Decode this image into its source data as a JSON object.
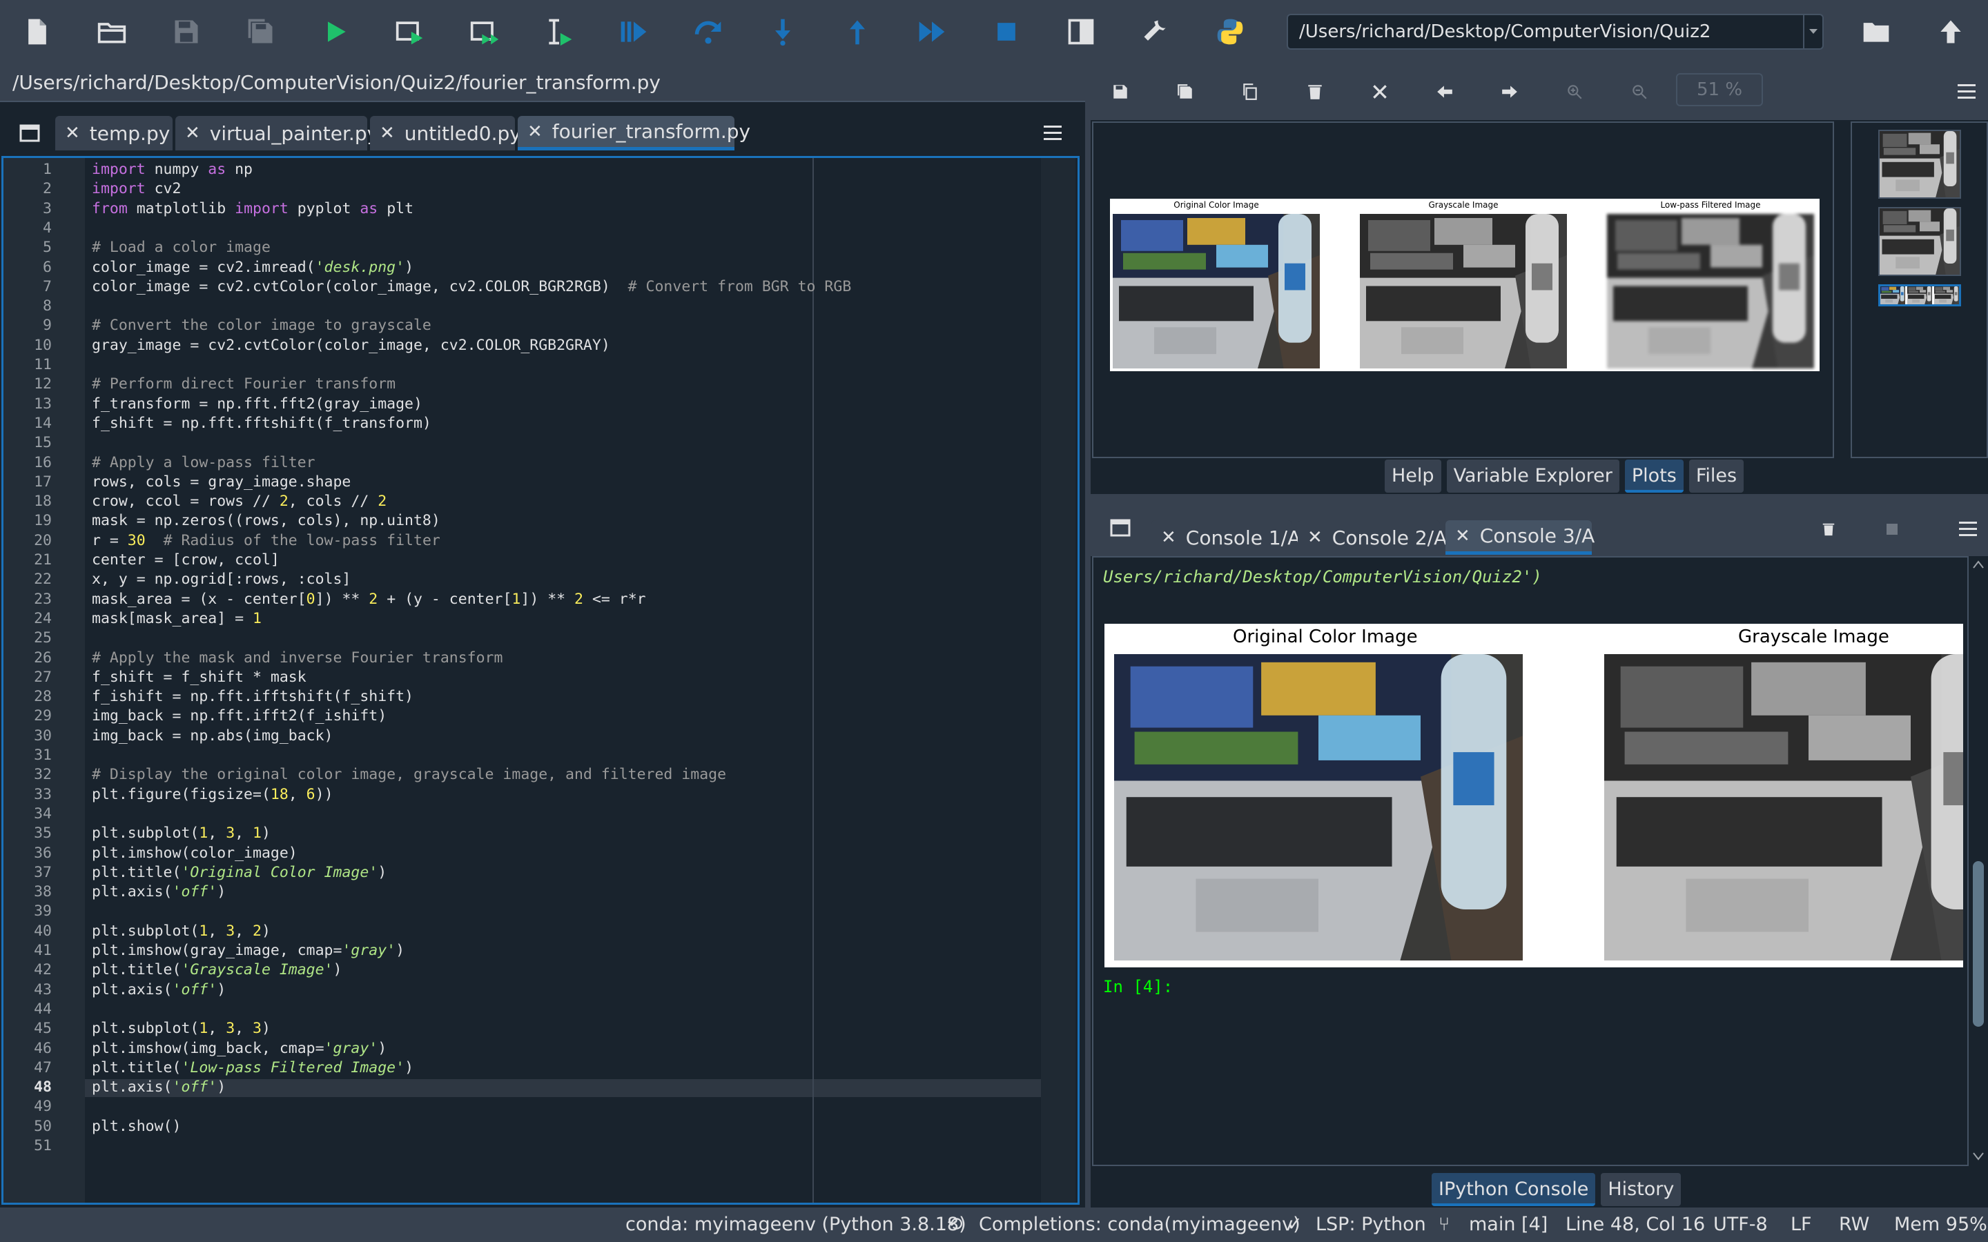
{
  "toolbar": {
    "buttons": [
      "new-file",
      "open-file",
      "save-file",
      "save-all",
      "run",
      "run-cell",
      "run-cell-advance",
      "run-selection",
      "debug",
      "step",
      "step-into",
      "step-return",
      "continue",
      "stop",
      "maximize-pane",
      "preferences",
      "python-path"
    ],
    "working_dir": "/Users/richard/Desktop/ComputerVision/Quiz2"
  },
  "editor": {
    "path": "/Users/richard/Desktop/ComputerVision/Quiz2/fourier_transform.py",
    "tabs": [
      {
        "label": "temp.py",
        "active": false
      },
      {
        "label": "virtual_painter.py",
        "active": false
      },
      {
        "label": "untitled0.py",
        "active": false
      },
      {
        "label": "fourier_transform.py",
        "active": true
      }
    ],
    "current_line": 48,
    "lines": [
      "import numpy as np",
      "import cv2",
      "from matplotlib import pyplot as plt",
      "",
      "# Load a color image",
      "color_image = cv2.imread('desk.png')",
      "color_image = cv2.cvtColor(color_image, cv2.COLOR_BGR2RGB)  # Convert from BGR to RGB",
      "",
      "# Convert the color image to grayscale",
      "gray_image = cv2.cvtColor(color_image, cv2.COLOR_RGB2GRAY)",
      "",
      "# Perform direct Fourier transform",
      "f_transform = np.fft.fft2(gray_image)",
      "f_shift = np.fft.fftshift(f_transform)",
      "",
      "# Apply a low-pass filter",
      "rows, cols = gray_image.shape",
      "crow, ccol = rows // 2, cols // 2",
      "mask = np.zeros((rows, cols), np.uint8)",
      "r = 30  # Radius of the low-pass filter",
      "center = [crow, ccol]",
      "x, y = np.ogrid[:rows, :cols]",
      "mask_area = (x - center[0]) ** 2 + (y - center[1]) ** 2 <= r*r",
      "mask[mask_area] = 1",
      "",
      "# Apply the mask and inverse Fourier transform",
      "f_shift = f_shift * mask",
      "f_ishift = np.fft.ifftshift(f_shift)",
      "img_back = np.fft.ifft2(f_ishift)",
      "img_back = np.abs(img_back)",
      "",
      "# Display the original color image, grayscale image, and filtered image",
      "plt.figure(figsize=(18, 6))",
      "",
      "plt.subplot(1, 3, 1)",
      "plt.imshow(color_image)",
      "plt.title('Original Color Image')",
      "plt.axis('off')",
      "",
      "plt.subplot(1, 3, 2)",
      "plt.imshow(gray_image, cmap='gray')",
      "plt.title('Grayscale Image')",
      "plt.axis('off')",
      "",
      "plt.subplot(1, 3, 3)",
      "plt.imshow(img_back, cmap='gray')",
      "plt.title('Low-pass Filtered Image')",
      "plt.axis('off')",
      "",
      "plt.show()",
      ""
    ]
  },
  "plots": {
    "zoom": "51 %",
    "titles": [
      "Original Color Image",
      "Grayscale Image",
      "Low-pass Filtered Image"
    ],
    "thumbnail_count": 3,
    "selected_thumbnail": 3,
    "pane_tabs": [
      {
        "label": "Help",
        "active": false
      },
      {
        "label": "Variable Explorer",
        "active": false
      },
      {
        "label": "Plots",
        "active": true
      },
      {
        "label": "Files",
        "active": false
      }
    ]
  },
  "console": {
    "tabs": [
      {
        "label": "Console 1/A",
        "active": false
      },
      {
        "label": "Console 2/A",
        "active": false
      },
      {
        "label": "Console 3/A",
        "active": true
      }
    ],
    "cut_line": "Users/richard/Desktop/ComputerVision/Quiz2')",
    "figure_titles": [
      "Original Color Image",
      "Grayscale Image"
    ],
    "prompt": "In [4]:",
    "pane_tabs": [
      {
        "label": "IPython Console",
        "active": true
      },
      {
        "label": "History",
        "active": false
      }
    ]
  },
  "status": {
    "env": "conda: myimageenv (Python 3.8.18)",
    "completions": "Completions: conda(myimageenv)",
    "lsp": "LSP: Python",
    "branch": "main [4]",
    "cursor": "Line 48, Col 16",
    "encoding": "UTF-8",
    "eol": "LF",
    "rw": "RW",
    "mem": "Mem 95%"
  },
  "colors": {
    "background": "#19232d",
    "panel": "#37414f",
    "accent": "#1a72bb",
    "keyword": "#c670e0",
    "string": "#b0e686",
    "number": "#faed5c",
    "comment": "#999999",
    "prompt": "#00ff00"
  }
}
